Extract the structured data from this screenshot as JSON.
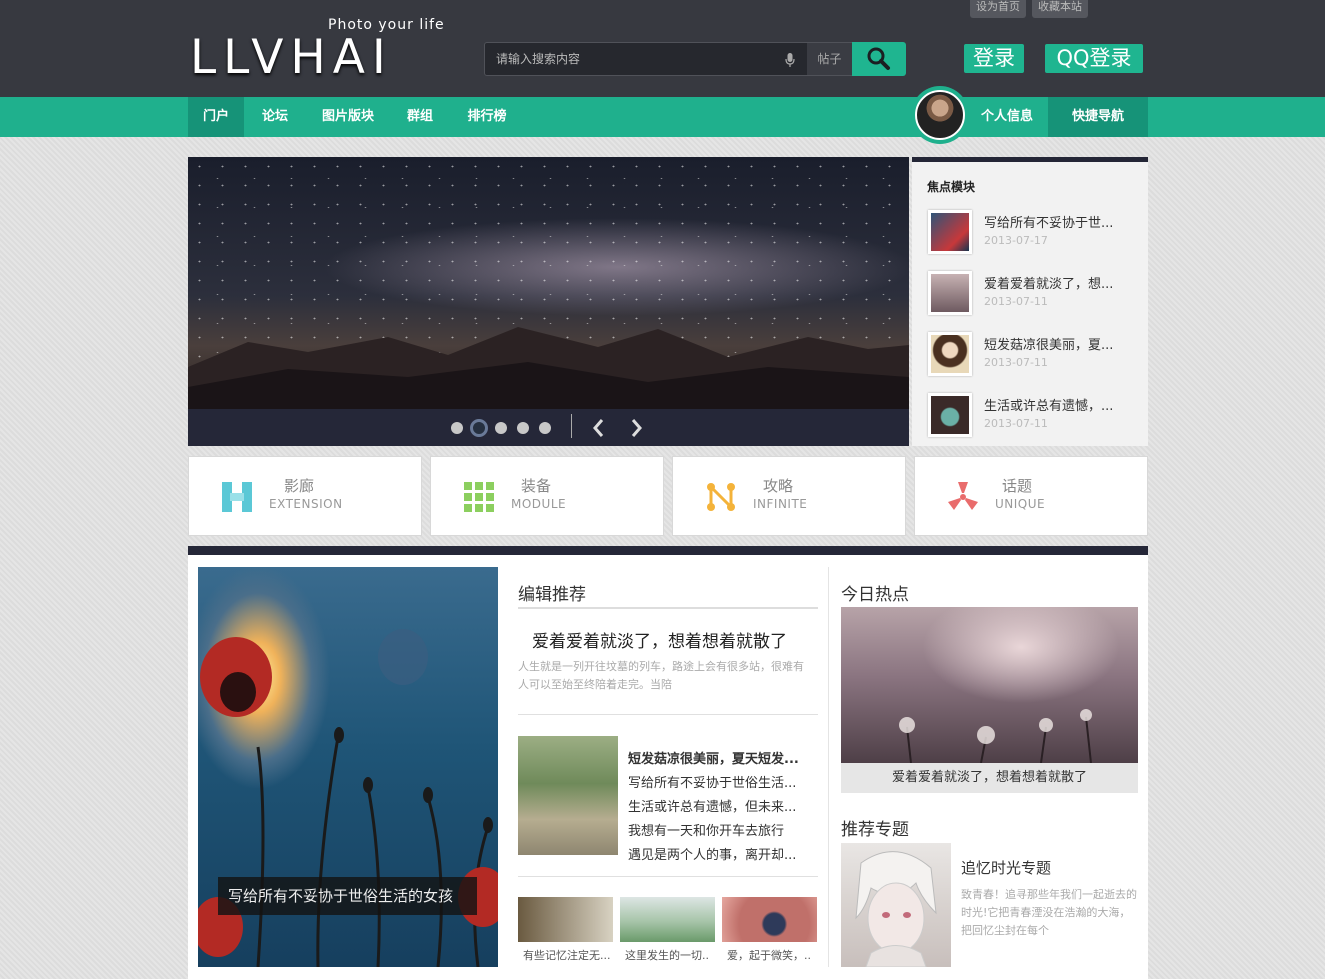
{
  "header": {
    "top_links": [
      "设为首页",
      "收藏本站"
    ],
    "slogan": "Photo your life",
    "logo": "LLVHAI",
    "search_placeholder": "请输入搜索内容",
    "search_type": "帖子",
    "login": "登录",
    "qq_login": "QQ登录"
  },
  "nav": {
    "items": [
      "门户",
      "论坛",
      "图片版块",
      "群组",
      "排行榜"
    ],
    "active": "门户",
    "profile": "个人信息",
    "quick_nav": "快捷导航"
  },
  "focus": {
    "title": "焦点模块",
    "items": [
      {
        "title": "写给所有不妥协于世...",
        "date": "2013-07-17"
      },
      {
        "title": "爱着爱着就淡了，想...",
        "date": "2013-07-11"
      },
      {
        "title": "短发菇凉很美丽，夏...",
        "date": "2013-07-11"
      },
      {
        "title": "生活或许总有遗憾，...",
        "date": "2013-07-11"
      }
    ]
  },
  "features": [
    {
      "title": "影廊",
      "subtitle": "EXTENSION",
      "icon": "extension-icon",
      "color": "#5bc8d6"
    },
    {
      "title": "装备",
      "subtitle": "MODULE",
      "icon": "grid-icon",
      "color": "#8ccf5f"
    },
    {
      "title": "攻略",
      "subtitle": "INFINITE",
      "icon": "network-icon",
      "color": "#f4b33a"
    },
    {
      "title": "话题",
      "subtitle": "UNIQUE",
      "icon": "radiation-icon",
      "color": "#e96c6c"
    }
  ],
  "main": {
    "big_caption": "写给所有不妥协于世俗生活的女孩",
    "editor_heading": "编辑推荐",
    "rec_title": "爱着爱着就淡了，想着想着就散了",
    "rec_desc": "人生就是一列开往坟墓的列车，路途上会有很多站，很难有人可以至始至终陪着走完。当陪",
    "list": [
      "短发菇凉很美丽，夏天短发...",
      "写给所有不妥协于世俗生活...",
      "生活或许总有遗憾，但未来...",
      "我想有一天和你开车去旅行",
      "遇见是两个人的事，离开却..."
    ],
    "thumbs": [
      "有些记忆注定无...",
      "这里发生的一切..",
      "爱，起于微笑，.."
    ],
    "hot_heading": "今日热点",
    "hot_caption": "爱着爱着就淡了，想着想着就散了",
    "topic_heading": "推荐专题",
    "topic_title": "追忆时光专题",
    "topic_desc": "致青春！追寻那些年我们一起逝去的时光!它把青春湮没在浩瀚的大海，把回忆尘封在每个"
  }
}
